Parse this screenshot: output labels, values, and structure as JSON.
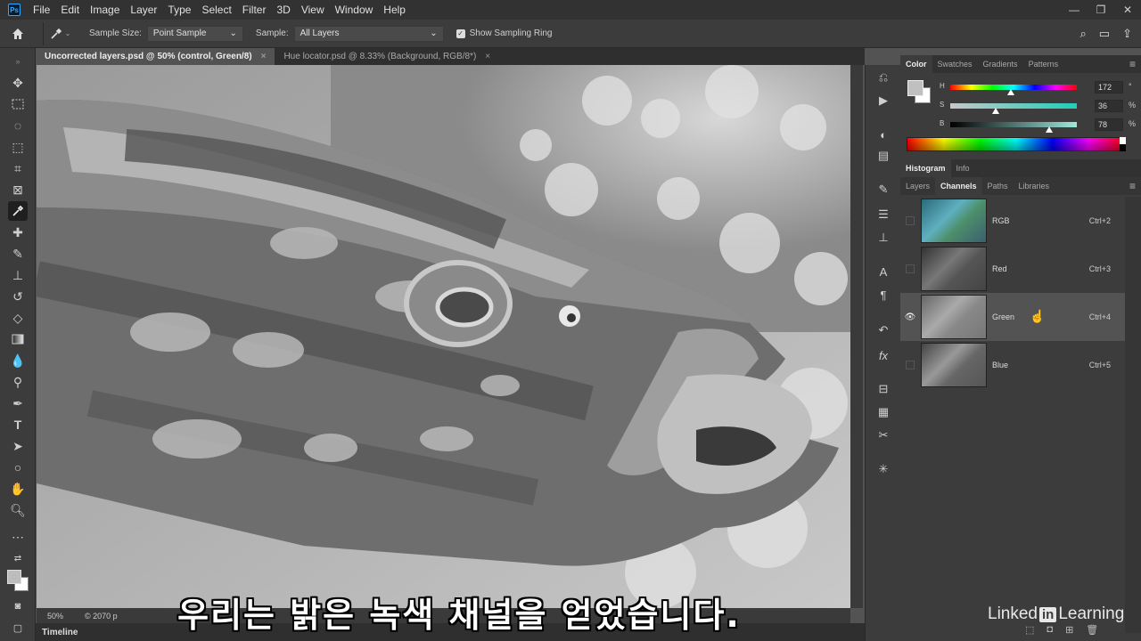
{
  "menubar": {
    "logo": "Ps",
    "items": [
      "File",
      "Edit",
      "Image",
      "Layer",
      "Type",
      "Select",
      "Filter",
      "3D",
      "View",
      "Window",
      "Help"
    ]
  },
  "options": {
    "sample_size_label": "Sample Size:",
    "sample_size_value": "Point Sample",
    "sample_label": "Sample:",
    "sample_value": "All Layers",
    "show_ring_label": "Show Sampling Ring"
  },
  "doc_tabs": [
    {
      "label": "Uncorrected layers.psd @ 50% (control, Green/8)",
      "active": true
    },
    {
      "label": "Hue locator.psd @ 8.33% (Background, RGB/8*)",
      "active": false
    }
  ],
  "status": {
    "zoom": "50%",
    "info": "© 2070 p"
  },
  "timeline": "Timeline",
  "color_panel": {
    "tabs": [
      "Color",
      "Swatches",
      "Gradients",
      "Patterns"
    ],
    "H": {
      "label": "H",
      "value": "172",
      "unit": "°",
      "fraction": 0.48
    },
    "S": {
      "label": "S",
      "value": "36",
      "unit": "%",
      "fraction": 0.36
    },
    "B": {
      "label": "B",
      "value": "78",
      "unit": "%",
      "fraction": 0.78
    }
  },
  "histogram_tabs": [
    "Histogram",
    "Info"
  ],
  "layer_tabs": [
    "Layers",
    "Channels",
    "Paths",
    "Libraries"
  ],
  "channels": [
    {
      "name": "RGB",
      "shortcut": "Ctrl+2",
      "visible": false,
      "selected": false
    },
    {
      "name": "Red",
      "shortcut": "Ctrl+3",
      "visible": false,
      "selected": false
    },
    {
      "name": "Green",
      "shortcut": "Ctrl+4",
      "visible": true,
      "selected": true
    },
    {
      "name": "Blue",
      "shortcut": "Ctrl+5",
      "visible": false,
      "selected": false
    }
  ],
  "subtitle": "우리는 밝은 녹색 채널을 얻었습니다.",
  "watermark": {
    "pre": "Linked",
    "in": "in",
    "post": " Learning"
  }
}
